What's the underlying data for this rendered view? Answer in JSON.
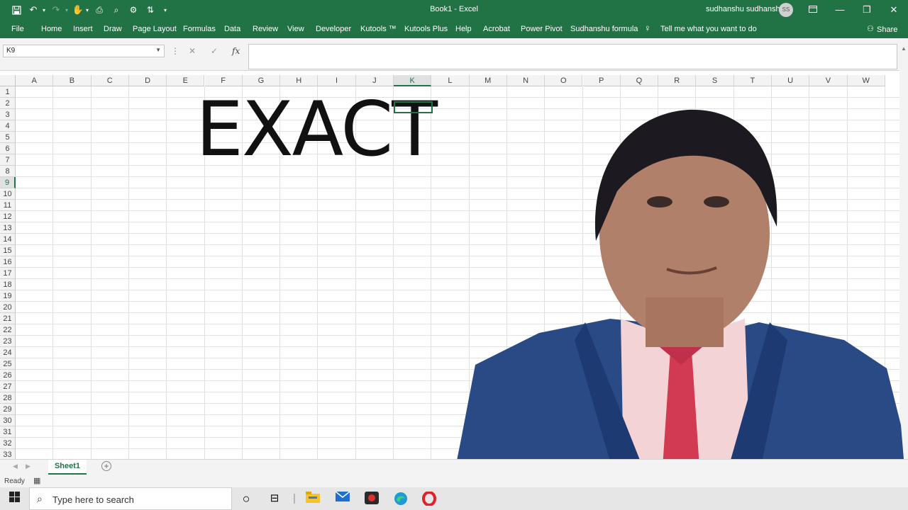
{
  "window": {
    "title": "Book1  -  Excel",
    "user_name": "sudhanshu sudhanshu",
    "user_initials": "SS"
  },
  "ribbon": {
    "tabs": [
      "File",
      "Home",
      "Insert",
      "Draw",
      "Page Layout",
      "Formulas",
      "Data",
      "Review",
      "View",
      "Developer",
      "Kutools ™",
      "Kutools Plus",
      "Help",
      "Acrobat",
      "Power Pivot",
      "Sudhanshu formula"
    ],
    "tell_me": "Tell me what you want to do",
    "share": "Share"
  },
  "formula_bar": {
    "name_box": "K9",
    "fx": "fx",
    "cancel": "✕",
    "enter": "✓",
    "content": ""
  },
  "grid": {
    "columns": [
      "A",
      "B",
      "C",
      "D",
      "E",
      "F",
      "G",
      "H",
      "I",
      "J",
      "K",
      "L",
      "M",
      "N",
      "O",
      "P",
      "Q",
      "R",
      "S",
      "T",
      "U",
      "V",
      "W"
    ],
    "rows": [
      "1",
      "2",
      "3",
      "4",
      "5",
      "6",
      "7",
      "8",
      "9",
      "10",
      "11",
      "12",
      "13",
      "14",
      "15",
      "16",
      "17",
      "18",
      "19",
      "20",
      "21",
      "22",
      "23",
      "24",
      "25",
      "26",
      "27",
      "28",
      "29",
      "30",
      "31",
      "32",
      "33"
    ],
    "selected_column": "K",
    "selected_row": "9",
    "big_text": "EXACT"
  },
  "sheets": {
    "active": "Sheet1",
    "add_label": "+"
  },
  "status": {
    "text": "Ready"
  },
  "taskbar": {
    "search_placeholder": "Type here to search"
  },
  "colors": {
    "excel_green": "#217346",
    "grid_line": "#e1e1e1",
    "header_bg": "#f3f3f3"
  }
}
